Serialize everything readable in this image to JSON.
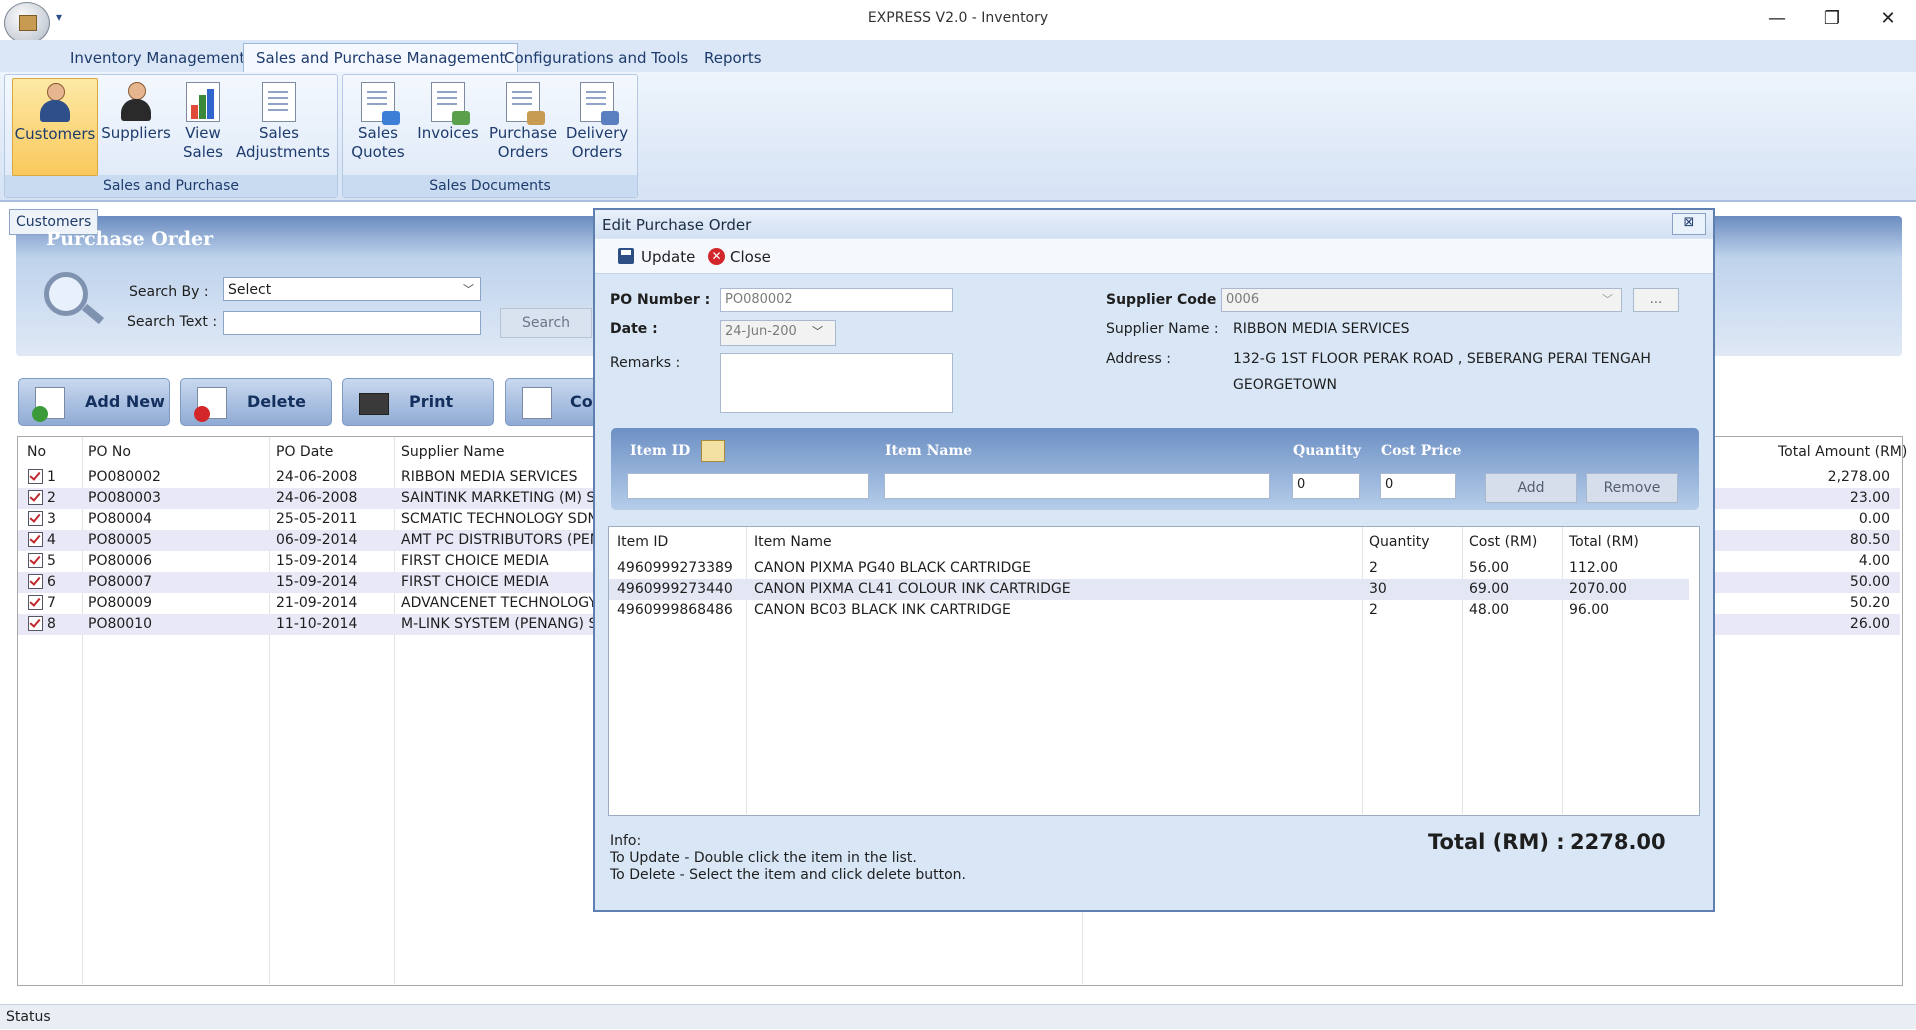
{
  "window": {
    "title": "EXPRESS V2.0 - Inventory",
    "minimize": "—",
    "restore": "❐",
    "close": "✕",
    "qat_arrow": "▾"
  },
  "ribbon": {
    "tabs": [
      "Inventory Management",
      "Sales and Purchase Management",
      "Configurations and Tools",
      "Reports"
    ],
    "active_tab": "Sales and Purchase Management",
    "groups": [
      {
        "label": "Sales and Purchase",
        "buttons": [
          {
            "line1": "Customers",
            "line2": "",
            "icon": "customer-icon",
            "active": true
          },
          {
            "line1": "Suppliers",
            "line2": "",
            "icon": "supplier-icon"
          },
          {
            "line1": "View",
            "line2": "Sales",
            "icon": "view-sales-icon"
          },
          {
            "line1": "Sales",
            "line2": "Adjustments",
            "icon": "sales-adjustments-icon"
          }
        ]
      },
      {
        "label": "Sales Documents",
        "buttons": [
          {
            "line1": "Sales",
            "line2": "Quotes",
            "icon": "sales-quotes-icon"
          },
          {
            "line1": "Invoices",
            "line2": "",
            "icon": "invoices-icon"
          },
          {
            "line1": "Purchase",
            "line2": "Orders",
            "icon": "purchase-orders-icon"
          },
          {
            "line1": "Delivery",
            "line2": "Orders",
            "icon": "delivery-orders-icon"
          }
        ]
      }
    ]
  },
  "doc_tab": "Customers",
  "po_panel": {
    "title": "Purchase Order",
    "search_by_label": "Search By :",
    "search_by_value": "Select",
    "search_text_label": "Search Text :",
    "search_button": "Search"
  },
  "actions": {
    "add_new": "Add New",
    "delete": "Delete",
    "print": "Print",
    "copy": "Co"
  },
  "po_grid": {
    "headers": {
      "no": "No",
      "po_no": "PO No",
      "po_date": "PO Date",
      "supplier": "Supplier Name",
      "total": "Total Amount (RM)"
    },
    "rows": [
      {
        "no": "1",
        "po_no": "PO080002",
        "date": "24-06-2008",
        "supplier": "RIBBON MEDIA SERVICES",
        "total": "2,278.00"
      },
      {
        "no": "2",
        "po_no": "PO080003",
        "date": "24-06-2008",
        "supplier": "SAINTINK MARKETING (M) SDN",
        "total": "23.00"
      },
      {
        "no": "3",
        "po_no": "PO80004",
        "date": "25-05-2011",
        "supplier": "SCMATIC TECHNOLOGY SDN BH",
        "total": "0.00"
      },
      {
        "no": "4",
        "po_no": "PO80005",
        "date": "06-09-2014",
        "supplier": "AMT PC DISTRIBUTORS (PENAN",
        "total": "80.50"
      },
      {
        "no": "5",
        "po_no": "PO80006",
        "date": "15-09-2014",
        "supplier": "FIRST CHOICE MEDIA",
        "total": "4.00"
      },
      {
        "no": "6",
        "po_no": "PO80007",
        "date": "15-09-2014",
        "supplier": "FIRST CHOICE MEDIA",
        "total": "50.00"
      },
      {
        "no": "7",
        "po_no": "PO80009",
        "date": "21-09-2014",
        "supplier": "ADVANCENET TECHNOLOGY (M",
        "total": "50.20"
      },
      {
        "no": "8",
        "po_no": "PO80010",
        "date": "11-10-2014",
        "supplier": "M-LINK SYSTEM (PENANG) SDN",
        "total": "26.00"
      }
    ]
  },
  "status": "Status",
  "dialog": {
    "title": "Edit Purchase Order",
    "close_x": "⊠",
    "update": "Update",
    "close": "Close",
    "po_number_label": "PO Number :",
    "po_number": "PO080002",
    "date_label": "Date :",
    "date": "24-Jun-200",
    "remarks_label": "Remarks :",
    "supplier_code_label": "Supplier Code :",
    "supplier_code": "0006",
    "browse": "...",
    "supplier_name_label": "Supplier Name :",
    "supplier_name": "RIBBON MEDIA SERVICES",
    "address_label": "Address :",
    "address_line1": "132-G 1ST FLOOR PERAK ROAD , SEBERANG PERAI TENGAH",
    "address_line2": "GEORGETOWN",
    "entry": {
      "item_id": "Item ID",
      "item_name": "Item Name",
      "quantity": "Quantity",
      "cost_price": "Cost Price",
      "quantity_value": "0",
      "cost_value": "0",
      "add": "Add",
      "remove": "Remove"
    },
    "items": {
      "headers": {
        "id": "Item ID",
        "name": "Item Name",
        "qty": "Quantity",
        "cost": "Cost (RM)",
        "total": "Total (RM)"
      },
      "rows": [
        {
          "id": "4960999273389",
          "name": "CANON PIXMA PG40 BLACK CARTRIDGE",
          "qty": "2",
          "cost": "56.00",
          "total": "112.00"
        },
        {
          "id": "4960999273440",
          "name": "CANON PIXMA CL41 COLOUR INK CARTRIDGE",
          "qty": "30",
          "cost": "69.00",
          "total": "2070.00"
        },
        {
          "id": "4960999868486",
          "name": "CANON BC03 BLACK INK CARTRIDGE",
          "qty": "2",
          "cost": "48.00",
          "total": "96.00"
        }
      ]
    },
    "info_title": "Info:",
    "info_update": "To Update - Double click the item in the list.",
    "info_delete": "To Delete - Select the item and click delete button.",
    "total_label": "Total (RM) :",
    "total_value": "2278.00"
  }
}
